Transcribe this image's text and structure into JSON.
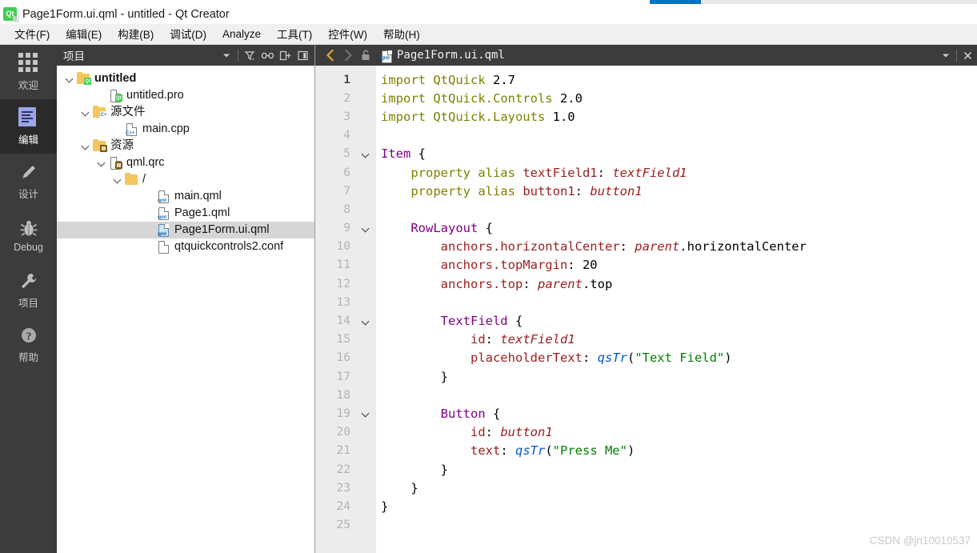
{
  "window": {
    "title": "Page1Form.ui.qml - untitled - Qt Creator",
    "app_icon": "qt-logo-icon",
    "app_icon_text": "Qt"
  },
  "progress_strip": {
    "value_pct": 16,
    "fill_color": "#0072c6",
    "track_color": "#e8e8e8"
  },
  "menubar": {
    "items": [
      {
        "label": "文件(F)",
        "name": "menu-file"
      },
      {
        "label": "编辑(E)",
        "name": "menu-edit"
      },
      {
        "label": "构建(B)",
        "name": "menu-build"
      },
      {
        "label": "调试(D)",
        "name": "menu-debug"
      },
      {
        "label": "Analyze",
        "name": "menu-analyze"
      },
      {
        "label": "工具(T)",
        "name": "menu-tools"
      },
      {
        "label": "控件(W)",
        "name": "menu-widgets"
      },
      {
        "label": "帮助(H)",
        "name": "menu-help"
      }
    ]
  },
  "activitybar": {
    "items": [
      {
        "label": "欢迎",
        "icon": "grid-icon",
        "selected": false
      },
      {
        "label": "编辑",
        "icon": "document-icon",
        "selected": true
      },
      {
        "label": "设计",
        "icon": "pencil-icon",
        "selected": false
      },
      {
        "label": "Debug",
        "icon": "bug-icon",
        "selected": false
      },
      {
        "label": "项目",
        "icon": "wrench-icon",
        "selected": false
      },
      {
        "label": "帮助",
        "icon": "question-circle-icon",
        "selected": false
      }
    ]
  },
  "project_panel": {
    "title": "项目",
    "header_buttons": [
      {
        "name": "mode-dropdown-icon",
        "glyph": "▾"
      },
      {
        "name": "filter-icon",
        "glyph": "filter"
      },
      {
        "name": "link-icon",
        "glyph": "link"
      },
      {
        "name": "split-icon",
        "glyph": "split"
      },
      {
        "name": "close-sidebar-icon",
        "glyph": "collapse"
      }
    ],
    "tree": [
      {
        "label": "untitled",
        "depth": 0,
        "expanded": true,
        "icon": "qt-project-folder-icon",
        "bold": true,
        "selected": false
      },
      {
        "label": "untitled.pro",
        "depth": 2,
        "expanded": null,
        "icon": "qt-pro-file-icon",
        "bold": false,
        "selected": false
      },
      {
        "label": "源文件",
        "depth": 1,
        "expanded": true,
        "icon": "cpp-folder-icon",
        "bold": false,
        "selected": false
      },
      {
        "label": "main.cpp",
        "depth": 3,
        "expanded": null,
        "icon": "cpp-file-icon",
        "bold": false,
        "selected": false
      },
      {
        "label": "资源",
        "depth": 1,
        "expanded": true,
        "icon": "resource-folder-icon",
        "bold": false,
        "selected": false
      },
      {
        "label": "qml.qrc",
        "depth": 2,
        "expanded": true,
        "icon": "qrc-file-icon",
        "bold": false,
        "selected": false
      },
      {
        "label": "/",
        "depth": 3,
        "expanded": true,
        "icon": "folder-icon",
        "bold": false,
        "selected": false
      },
      {
        "label": "main.qml",
        "depth": 5,
        "expanded": null,
        "icon": "qml-file-icon",
        "bold": false,
        "selected": false
      },
      {
        "label": "Page1.qml",
        "depth": 5,
        "expanded": null,
        "icon": "qml-file-icon",
        "bold": false,
        "selected": false
      },
      {
        "label": "Page1Form.ui.qml",
        "depth": 5,
        "expanded": null,
        "icon": "qml-file-icon-active",
        "bold": false,
        "selected": true
      },
      {
        "label": "qtquickcontrols2.conf",
        "depth": 5,
        "expanded": null,
        "icon": "conf-file-icon",
        "bold": false,
        "selected": false
      }
    ]
  },
  "editor": {
    "toolbar": {
      "back_label": "◀",
      "forward_label": "▶",
      "lock_icon": "unlocked-padlock-icon",
      "file_icon": "qml-file-icon",
      "filename": "Page1Form.ui.qml",
      "dropdown_glyph": "▾",
      "close_glyph": "✕"
    },
    "current_line": 1,
    "total_lines": 25,
    "lines": [
      {
        "n": "1",
        "fold": false,
        "tokens": [
          {
            "t": "import ",
            "c": "kw"
          },
          {
            "t": "QtQuick ",
            "c": "kw"
          },
          {
            "t": "2.7",
            "c": "num"
          }
        ]
      },
      {
        "n": "2",
        "fold": false,
        "tokens": [
          {
            "t": "import ",
            "c": "kw"
          },
          {
            "t": "QtQuick.Controls ",
            "c": "kw"
          },
          {
            "t": "2.0",
            "c": "num"
          }
        ]
      },
      {
        "n": "3",
        "fold": false,
        "tokens": [
          {
            "t": "import ",
            "c": "kw"
          },
          {
            "t": "QtQuick.Layouts ",
            "c": "kw"
          },
          {
            "t": "1.0",
            "c": "num"
          }
        ]
      },
      {
        "n": "4",
        "fold": false,
        "tokens": []
      },
      {
        "n": "5",
        "fold": true,
        "tokens": [
          {
            "t": "Item",
            "c": "type"
          },
          {
            "t": " {",
            "c": "plain"
          }
        ]
      },
      {
        "n": "6",
        "fold": false,
        "tokens": [
          {
            "t": "    ",
            "c": "plain"
          },
          {
            "t": "property alias ",
            "c": "kw"
          },
          {
            "t": "textField1",
            "c": "prop"
          },
          {
            "t": ": ",
            "c": "plain"
          },
          {
            "t": "textField1",
            "c": "val"
          }
        ]
      },
      {
        "n": "7",
        "fold": false,
        "tokens": [
          {
            "t": "    ",
            "c": "plain"
          },
          {
            "t": "property alias ",
            "c": "kw"
          },
          {
            "t": "button1",
            "c": "prop"
          },
          {
            "t": ": ",
            "c": "plain"
          },
          {
            "t": "button1",
            "c": "val"
          }
        ]
      },
      {
        "n": "8",
        "fold": false,
        "tokens": []
      },
      {
        "n": "9",
        "fold": true,
        "tokens": [
          {
            "t": "    ",
            "c": "plain"
          },
          {
            "t": "RowLayout",
            "c": "type"
          },
          {
            "t": " {",
            "c": "plain"
          }
        ]
      },
      {
        "n": "10",
        "fold": false,
        "tokens": [
          {
            "t": "        ",
            "c": "plain"
          },
          {
            "t": "anchors.horizontalCenter",
            "c": "prop"
          },
          {
            "t": ": ",
            "c": "plain"
          },
          {
            "t": "parent",
            "c": "val"
          },
          {
            "t": ".horizontalCenter",
            "c": "plain"
          }
        ]
      },
      {
        "n": "11",
        "fold": false,
        "tokens": [
          {
            "t": "        ",
            "c": "plain"
          },
          {
            "t": "anchors.topMargin",
            "c": "prop"
          },
          {
            "t": ": ",
            "c": "plain"
          },
          {
            "t": "20",
            "c": "num"
          }
        ]
      },
      {
        "n": "12",
        "fold": false,
        "tokens": [
          {
            "t": "        ",
            "c": "plain"
          },
          {
            "t": "anchors.top",
            "c": "prop"
          },
          {
            "t": ": ",
            "c": "plain"
          },
          {
            "t": "parent",
            "c": "val"
          },
          {
            "t": ".top",
            "c": "plain"
          }
        ]
      },
      {
        "n": "13",
        "fold": false,
        "tokens": []
      },
      {
        "n": "14",
        "fold": true,
        "tokens": [
          {
            "t": "        ",
            "c": "plain"
          },
          {
            "t": "TextField",
            "c": "type"
          },
          {
            "t": " {",
            "c": "plain"
          }
        ]
      },
      {
        "n": "15",
        "fold": false,
        "tokens": [
          {
            "t": "            ",
            "c": "plain"
          },
          {
            "t": "id",
            "c": "prop"
          },
          {
            "t": ": ",
            "c": "plain"
          },
          {
            "t": "textField1",
            "c": "val"
          }
        ]
      },
      {
        "n": "16",
        "fold": false,
        "tokens": [
          {
            "t": "            ",
            "c": "plain"
          },
          {
            "t": "placeholderText",
            "c": "prop"
          },
          {
            "t": ": ",
            "c": "plain"
          },
          {
            "t": "qsTr",
            "c": "fn"
          },
          {
            "t": "(",
            "c": "plain"
          },
          {
            "t": "\"Text Field\"",
            "c": "str"
          },
          {
            "t": ")",
            "c": "plain"
          }
        ]
      },
      {
        "n": "17",
        "fold": false,
        "tokens": [
          {
            "t": "        }",
            "c": "plain"
          }
        ]
      },
      {
        "n": "18",
        "fold": false,
        "tokens": []
      },
      {
        "n": "19",
        "fold": true,
        "tokens": [
          {
            "t": "        ",
            "c": "plain"
          },
          {
            "t": "Button",
            "c": "type"
          },
          {
            "t": " {",
            "c": "plain"
          }
        ]
      },
      {
        "n": "20",
        "fold": false,
        "tokens": [
          {
            "t": "            ",
            "c": "plain"
          },
          {
            "t": "id",
            "c": "prop"
          },
          {
            "t": ": ",
            "c": "plain"
          },
          {
            "t": "button1",
            "c": "val"
          }
        ]
      },
      {
        "n": "21",
        "fold": false,
        "tokens": [
          {
            "t": "            ",
            "c": "plain"
          },
          {
            "t": "text",
            "c": "prop"
          },
          {
            "t": ": ",
            "c": "plain"
          },
          {
            "t": "qsTr",
            "c": "fn"
          },
          {
            "t": "(",
            "c": "plain"
          },
          {
            "t": "\"Press Me\"",
            "c": "str"
          },
          {
            "t": ")",
            "c": "plain"
          }
        ]
      },
      {
        "n": "22",
        "fold": false,
        "tokens": [
          {
            "t": "        }",
            "c": "plain"
          }
        ]
      },
      {
        "n": "23",
        "fold": false,
        "tokens": [
          {
            "t": "    }",
            "c": "plain"
          }
        ]
      },
      {
        "n": "24",
        "fold": false,
        "tokens": [
          {
            "t": "}",
            "c": "plain"
          }
        ]
      },
      {
        "n": "25",
        "fold": false,
        "tokens": []
      }
    ]
  },
  "watermark": "CSDN @jn10010537",
  "colors": {
    "chrome_dark": "#3c3c3c",
    "activity_selected": "#2a2a2a",
    "menubar": "#f0f0f0",
    "gutter": "#ececec",
    "tree_selection": "#d6d6d6",
    "accent_blue": "#0072c6",
    "qt_green": "#41cd52"
  }
}
